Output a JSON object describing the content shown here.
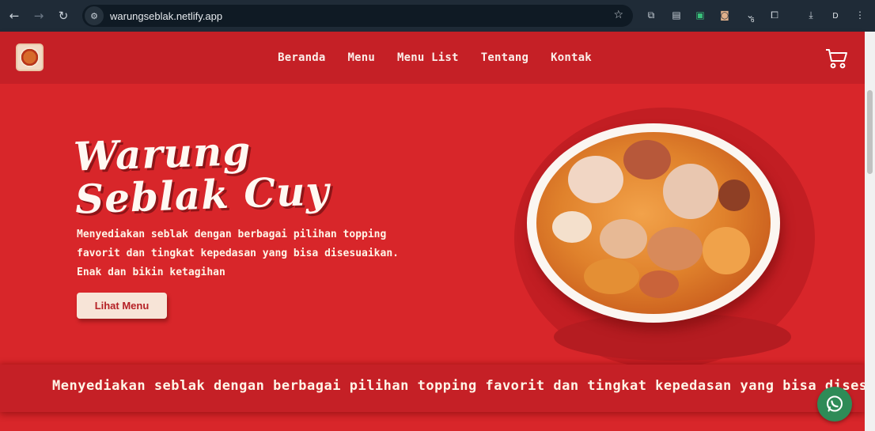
{
  "browser": {
    "url": "warungseblak.netlify.app",
    "extension_badge": "6",
    "profile_initial": "D",
    "icons": [
      "back-icon",
      "forward-icon",
      "reload-icon",
      "site-info-icon",
      "bookmark-star-icon",
      "translate-icon",
      "clipboard-icon",
      "screenshot-icon",
      "camera-icon",
      "tab-search-icon",
      "extensions-icon",
      "download-icon",
      "menu-icon"
    ]
  },
  "header": {
    "nav": [
      "Beranda",
      "Menu",
      "Menu List",
      "Tentang",
      "Kontak"
    ],
    "cart_icon": "cart-icon",
    "logo_icon": "bowl-logo"
  },
  "hero": {
    "title_line1": "Warung",
    "title_line2": "Seblak Cuy",
    "description": "Menyediakan seblak dengan berbagai pilihan topping favorit dan tingkat kepedasan yang bisa disesuaikan. Enak dan bikin ketagihan",
    "cta_label": "Lihat Menu"
  },
  "marquee": {
    "text": "Menyediakan seblak dengan berbagai pilihan topping favorit dan tingkat kepedasan yang bisa disesuaikan"
  },
  "colors": {
    "brand_red": "#d8262a",
    "header_red": "#c52026",
    "cream": "#f7e4d7",
    "whatsapp_green": "#2e8b57"
  }
}
